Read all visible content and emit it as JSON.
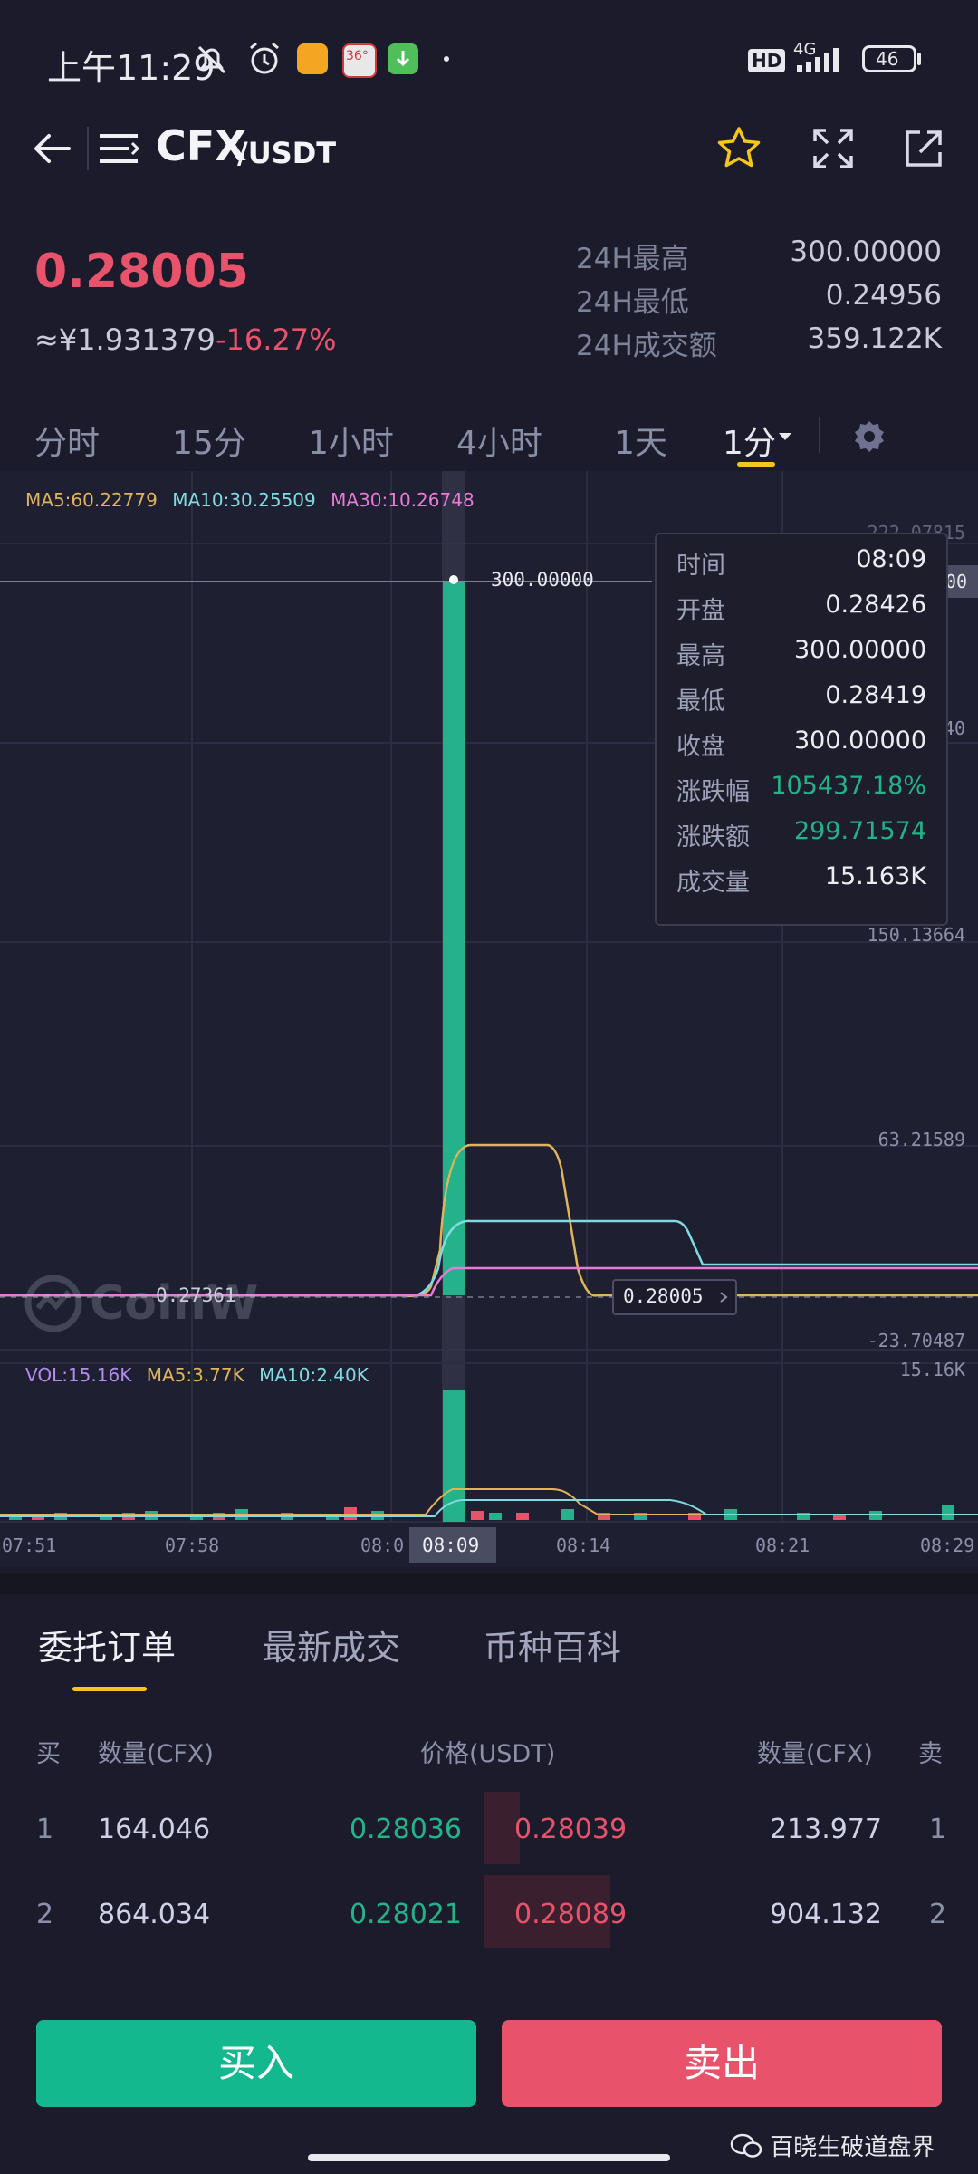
{
  "status_bar": {
    "time": "上午11:29",
    "app_badge": "36°",
    "network": "HD",
    "network_type": "4G",
    "battery": "46"
  },
  "header": {
    "base": "CFX",
    "quote": "/USDT"
  },
  "price": {
    "last": "0.28005",
    "cny": "≈¥1.931379",
    "change": "-16.27%",
    "stats": [
      {
        "label": "24H最高",
        "value": "300.00000"
      },
      {
        "label": "24H最低",
        "value": "0.24956"
      },
      {
        "label": "24H成交额",
        "value": "359.122K"
      }
    ]
  },
  "timeframes": [
    "分时",
    "15分",
    "1小时",
    "4小时",
    "1天",
    "1分"
  ],
  "active_timeframe": "1分",
  "ma": {
    "ma5": "MA5:60.22779",
    "ma10": "MA10:30.25509",
    "ma30": "MA30:10.26748"
  },
  "price_axis": [
    "222.07815",
    "40",
    "150.13664",
    "63.21589",
    "-23.70487"
  ],
  "price_axis_cut": "00",
  "labels": {
    "high": "300.00000",
    "left_price": "0.27361",
    "current": "0.28005",
    "watermark": "CoinW"
  },
  "tooltip": [
    {
      "k": "时间",
      "v": "08:09"
    },
    {
      "k": "开盘",
      "v": "0.28426"
    },
    {
      "k": "最高",
      "v": "300.00000"
    },
    {
      "k": "最低",
      "v": "0.28419"
    },
    {
      "k": "收盘",
      "v": "300.00000"
    },
    {
      "k": "涨跌幅",
      "v": "105437.18%"
    },
    {
      "k": "涨跌额",
      "v": "299.71574"
    },
    {
      "k": "成交量",
      "v": "15.163K"
    }
  ],
  "vol": {
    "vol": "VOL:15.16K",
    "ma5": "MA5:3.77K",
    "ma10": "MA10:2.40K",
    "axis_max": "15.16K"
  },
  "time_axis": [
    "07:51",
    "07:58",
    "08:0",
    "08:09",
    "08:14",
    "08:21",
    "08:29"
  ],
  "order_tabs": [
    "委托订单",
    "最新成交",
    "币种百科"
  ],
  "orderbook": {
    "headers": [
      "买",
      "数量(CFX)",
      "价格(USDT)",
      "数量(CFX)",
      "卖"
    ],
    "rows": [
      {
        "idx": "1",
        "bid_qty": "164.046",
        "bid": "0.28036",
        "ask": "0.28039",
        "ask_qty": "213.977",
        "idx2": "1"
      },
      {
        "idx": "2",
        "bid_qty": "864.034",
        "bid": "0.28021",
        "ask": "0.28089",
        "ask_qty": "904.132",
        "idx2": "2"
      }
    ]
  },
  "buttons": {
    "buy": "买入",
    "sell": "卖出"
  },
  "footer": {
    "wechat": "百晓生破道盘界"
  },
  "colors": {
    "green": "#23b28a",
    "red": "#e8536b",
    "accent": "#f5c518",
    "bg": "#1b1b2b"
  }
}
